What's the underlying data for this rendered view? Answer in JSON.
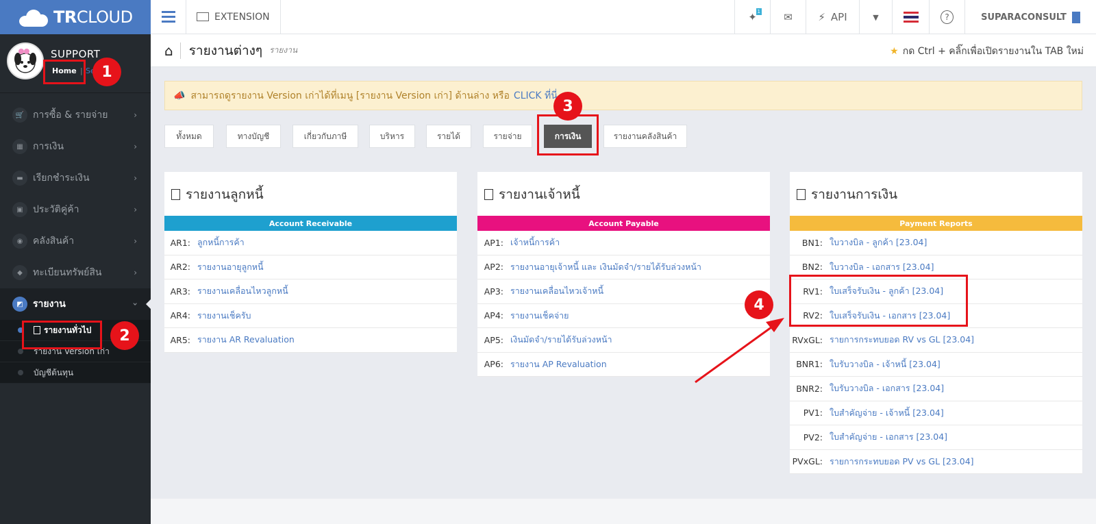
{
  "brand": {
    "bold": "TR",
    "light": "CLOUD"
  },
  "profile": {
    "name": "SUPPORT",
    "home": "Home",
    "separator": "|",
    "other": "Se"
  },
  "sidebar": {
    "items": [
      {
        "label": "การซื้อ & รายจ่าย",
        "icon": "cart-icon"
      },
      {
        "label": "การเงิน",
        "icon": "calendar-icon"
      },
      {
        "label": "เรียกชำระเงิน",
        "icon": "card-icon"
      },
      {
        "label": "ประวัติคู่ค้า",
        "icon": "contact-icon"
      },
      {
        "label": "คลังสินค้า",
        "icon": "boxes-icon"
      },
      {
        "label": "ทะเบียนทรัพย์สิน",
        "icon": "diamond-icon"
      },
      {
        "label": "รายงาน",
        "icon": "report-icon"
      }
    ],
    "subitems": [
      {
        "label": "รายงานทั่วไป"
      },
      {
        "label": "รายงาน Version เก่า"
      },
      {
        "label": "บัญชีต้นทุน"
      }
    ]
  },
  "topbar": {
    "extension": "EXTENSION",
    "badge": "1",
    "api": "API",
    "user": "SUPARACONSULT"
  },
  "page": {
    "title": "รายงานต่างๆ",
    "subtitle": "รายงาน",
    "tip": "กด Ctrl + คลิ๊กเพื่อเปิดรายงานใน TAB ใหม่"
  },
  "notice": {
    "text": "สามารถดูรายงาน Version เก่าได้ที่เมนู [รายงาน Version เก่า] ด้านล่าง หรือ",
    "link": "CLICK ที่นี่"
  },
  "filters": [
    "ทั้งหมด",
    "ทางบัญชี",
    "เกี่ยวกับภาษี",
    "บริหาร",
    "รายได้",
    "รายจ่าย",
    "การเงิน",
    "รายงานคลังสินค้า"
  ],
  "panels": [
    {
      "title": "รายงานลูกหนี้",
      "header": "Account Receivable",
      "color": "#1ea0cf",
      "rows": [
        {
          "code": "AR1:",
          "label": "ลูกหนี้การค้า"
        },
        {
          "code": "AR2:",
          "label": "รายงานอายุลูกหนี้"
        },
        {
          "code": "AR3:",
          "label": "รายงานเคลื่อนไหวลูกหนี้"
        },
        {
          "code": "AR4:",
          "label": "รายงานเช็ครับ"
        },
        {
          "code": "AR5:",
          "label": "รายงาน AR Revaluation"
        }
      ]
    },
    {
      "title": "รายงานเจ้าหนี้",
      "header": "Account Payable",
      "color": "#e8117f",
      "rows": [
        {
          "code": "AP1:",
          "label": "เจ้าหนี้การค้า"
        },
        {
          "code": "AP2:",
          "label": "รายงานอายุเจ้าหนี้ และ เงินมัดจำ/รายได้รับล่วงหน้า"
        },
        {
          "code": "AP3:",
          "label": "รายงานเคลื่อนไหวเจ้าหนี้"
        },
        {
          "code": "AP4:",
          "label": "รายงานเช็คจ่าย"
        },
        {
          "code": "AP5:",
          "label": "เงินมัดจำ/รายได้รับล่วงหน้า"
        },
        {
          "code": "AP6:",
          "label": "รายงาน AP Revaluation"
        }
      ]
    },
    {
      "title": "รายงานการเงิน",
      "header": "Payment Reports",
      "color": "#f5bb3d",
      "rows": [
        {
          "code": "BN1:",
          "label": "ใบวางบิล - ลูกค้า [23.04]"
        },
        {
          "code": "BN2:",
          "label": "ใบวางบิล - เอกสาร [23.04]"
        },
        {
          "code": "RV1:",
          "label": "ใบเสร็จรับเงิน - ลูกค้า [23.04]"
        },
        {
          "code": "RV2:",
          "label": "ใบเสร็จรับเงิน - เอกสาร [23.04]"
        },
        {
          "code": "RVxGL:",
          "label": "รายการกระทบยอด RV vs GL [23.04]"
        },
        {
          "code": "BNR1:",
          "label": "ใบรับวางบิล - เจ้าหนี้ [23.04]"
        },
        {
          "code": "BNR2:",
          "label": "ใบรับวางบิล - เอกสาร [23.04]"
        },
        {
          "code": "PV1:",
          "label": "ใบสำคัญจ่าย - เจ้าหนี้ [23.04]"
        },
        {
          "code": "PV2:",
          "label": "ใบสำคัญจ่าย - เอกสาร [23.04]"
        },
        {
          "code": "PVxGL:",
          "label": "รายการกระทบยอด PV vs GL [23.04]"
        }
      ]
    }
  ],
  "annotations": [
    "1",
    "2",
    "3",
    "4"
  ]
}
